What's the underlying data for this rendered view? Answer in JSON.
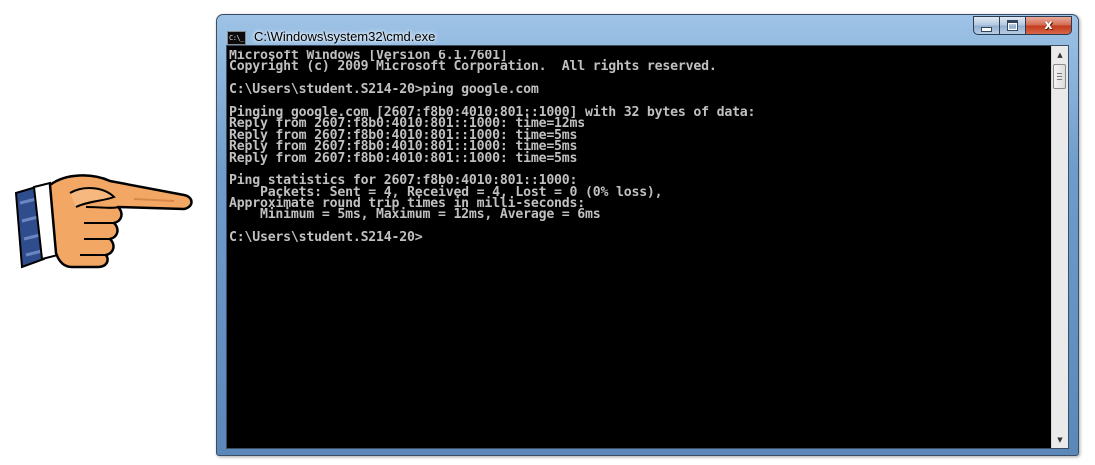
{
  "window": {
    "title": "C:\\Windows\\system32\\cmd.exe",
    "icon": "cmd-icon",
    "icon_text": "C:\\_"
  },
  "caption_buttons": {
    "minimize_icon": "minimize-icon",
    "maximize_icon": "maximize-icon",
    "close_icon": "close-icon",
    "close_glyph": "x"
  },
  "console": {
    "background_color": "#000000",
    "text_color": "#c0c0c0",
    "lines": [
      "Microsoft Windows [Version 6.1.7601]",
      "Copyright (c) 2009 Microsoft Corporation.  All rights reserved.",
      "",
      "C:\\Users\\student.S214-20>ping google.com",
      "",
      "Pinging google.com [2607:f8b0:4010:801::1000] with 32 bytes of data:",
      "Reply from 2607:f8b0:4010:801::1000: time=12ms",
      "Reply from 2607:f8b0:4010:801::1000: time=5ms",
      "Reply from 2607:f8b0:4010:801::1000: time=5ms",
      "Reply from 2607:f8b0:4010:801::1000: time=5ms",
      "",
      "Ping statistics for 2607:f8b0:4010:801::1000:",
      "    Packets: Sent = 4, Received = 4, Lost = 0 (0% loss),",
      "Approximate round trip times in milli-seconds:",
      "    Minimum = 5ms, Maximum = 12ms, Average = 6ms",
      "",
      "C:\\Users\\student.S214-20>"
    ]
  },
  "scrollbar": {
    "up_icon": "scroll-up-arrow-icon",
    "down_icon": "scroll-down-arrow-icon"
  },
  "decoration": {
    "pointer_icon": "pointing-hand-icon"
  }
}
